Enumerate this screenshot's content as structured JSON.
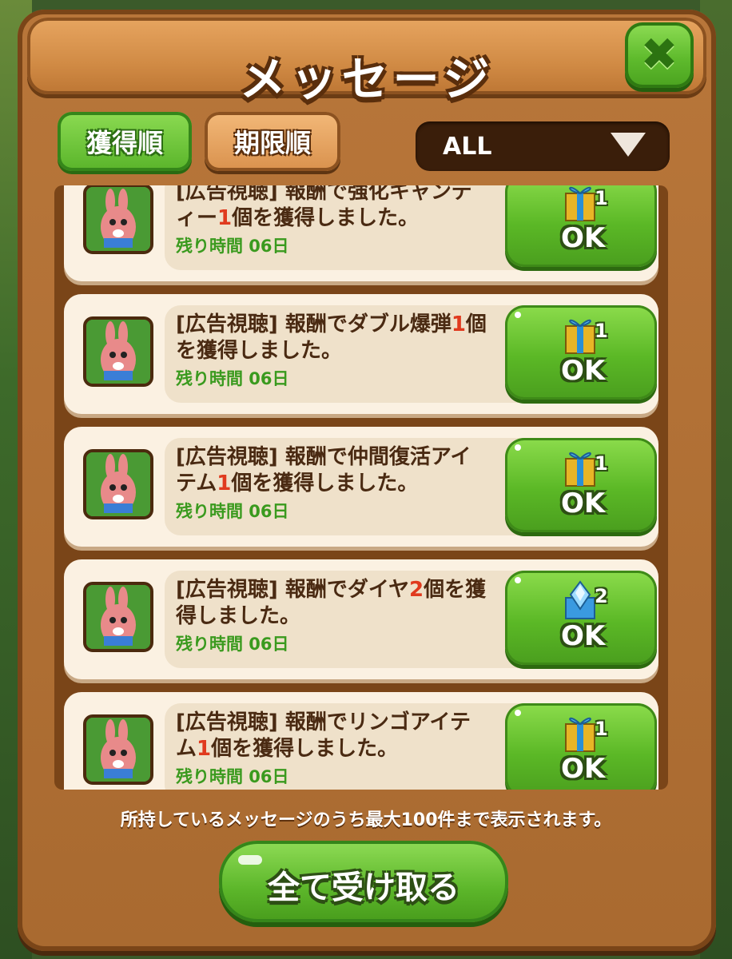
{
  "title": "メッセージ",
  "close_label": "✖",
  "tabs": [
    {
      "label": "獲得順",
      "active": true
    },
    {
      "label": "期限順",
      "active": false
    }
  ],
  "filter": {
    "selected": "ALL"
  },
  "messages": [
    {
      "prefix": "[広告視聴] 報酬で強化キャンディー",
      "count": "1",
      "suffix": "個を獲得しました。",
      "time": "残り時間 06日",
      "button": "OK",
      "reward_count": "1",
      "reward_icon": "gift-box-icon"
    },
    {
      "prefix": "[広告視聴] 報酬でダブル爆弾",
      "count": "1",
      "suffix": "個を獲得しました。",
      "time": "残り時間 06日",
      "button": "OK",
      "reward_count": "1",
      "reward_icon": "gift-box-icon"
    },
    {
      "prefix": "[広告視聴] 報酬で仲間復活アイテム",
      "count": "1",
      "suffix": "個を獲得しました。",
      "time": "残り時間 06日",
      "button": "OK",
      "reward_count": "1",
      "reward_icon": "gift-box-icon"
    },
    {
      "prefix": "[広告視聴] 報酬でダイヤ",
      "count": "2",
      "suffix": "個を獲得しました。",
      "time": "残り時間 06日",
      "button": "OK",
      "reward_count": "2",
      "reward_icon": "diamond-icon"
    },
    {
      "prefix": "[広告視聴] 報酬でリンゴアイテム",
      "count": "1",
      "suffix": "個を獲得しました。",
      "time": "残り時間 06日",
      "button": "OK",
      "reward_count": "1",
      "reward_icon": "gift-box-icon"
    }
  ],
  "footer_note": "所持しているメッセージのうち最大100件まで表示されます。",
  "claim_all_label": "全て受け取る",
  "colors": {
    "accent_green": "#5bb826",
    "wood": "#b8763a",
    "highlight_red": "#e03a1e",
    "time_green": "#3a9a1e"
  }
}
